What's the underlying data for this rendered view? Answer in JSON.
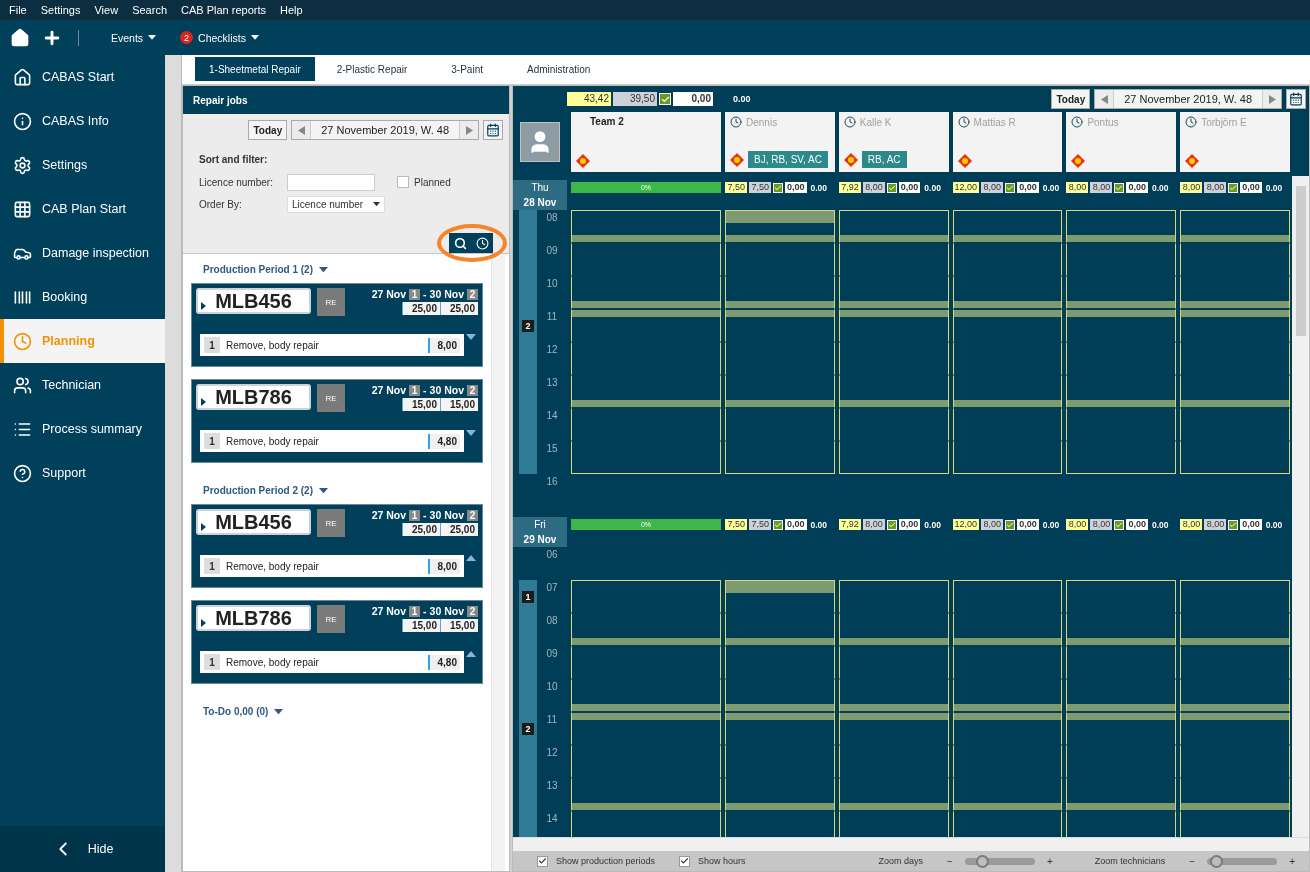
{
  "menu": [
    "File",
    "Settings",
    "View",
    "Search",
    "CAB Plan reports",
    "Help"
  ],
  "toolbar": {
    "events": "Events",
    "checklists": "Checklists",
    "badge": "2"
  },
  "sidebar": {
    "items": [
      {
        "label": "CABAS Start",
        "selected": false
      },
      {
        "label": "CABAS Info",
        "selected": false
      },
      {
        "label": "Settings",
        "selected": false
      },
      {
        "label": "CAB Plan Start",
        "selected": false
      },
      {
        "label": "Damage inspection",
        "selected": false
      },
      {
        "label": "Booking",
        "selected": false
      },
      {
        "label": "Planning",
        "selected": true
      },
      {
        "label": "Technician",
        "selected": false
      },
      {
        "label": "Process summary",
        "selected": false
      },
      {
        "label": "Support",
        "selected": false
      }
    ],
    "hide": "Hide"
  },
  "tabs": [
    {
      "label": "1-Sheetmetal Repair",
      "selected": true
    },
    {
      "label": "2-Plastic Repair",
      "selected": false
    },
    {
      "label": "3-Paint",
      "selected": false
    },
    {
      "label": "Administration",
      "selected": false
    }
  ],
  "repair_jobs": {
    "title": "Repair jobs",
    "today": "Today",
    "date": "27 November 2019, W. 48",
    "sort_title": "Sort and filter:",
    "licence_label": "Licence number:",
    "planned": {
      "label": "Planned",
      "checked": false
    },
    "order_label": "Order By:",
    "order_value": "Licence number",
    "groups": [
      {
        "title": "Production Period 1 (2)",
        "expanded": true,
        "jobs": [
          {
            "plate": "MLB456",
            "type": "RE",
            "start": "27 Nov",
            "start_day": "1",
            "separator": "-",
            "end": "30 Nov",
            "end_day": "2",
            "hours": [
              "25,00",
              "25,00"
            ],
            "task": {
              "index": "1",
              "name": "Remove, body repair",
              "hours": "8,00",
              "open": false
            }
          },
          {
            "plate": "MLB786",
            "type": "RE",
            "start": "27 Nov",
            "start_day": "1",
            "separator": "-",
            "end": "30 Nov",
            "end_day": "2",
            "hours": [
              "15,00",
              "15,00"
            ],
            "task": {
              "index": "1",
              "name": "Remove, body repair",
              "hours": "4,80",
              "open": false
            }
          }
        ]
      },
      {
        "title": "Production Period 2 (2)",
        "expanded": true,
        "jobs": [
          {
            "plate": "MLB456",
            "type": "RE",
            "start": "27 Nov",
            "start_day": "1",
            "separator": "-",
            "end": "30 Nov",
            "end_day": "2",
            "hours": [
              "25,00",
              "25,00"
            ],
            "task": {
              "index": "1",
              "name": "Remove, body repair",
              "hours": "8,00",
              "open": true
            }
          },
          {
            "plate": "MLB786",
            "type": "RE",
            "start": "27 Nov",
            "start_day": "1",
            "separator": "-",
            "end": "30 Nov",
            "end_day": "2",
            "hours": [
              "15,00",
              "15,00"
            ],
            "task": {
              "index": "1",
              "name": "Remove, body repair",
              "hours": "4,80",
              "open": true
            }
          }
        ]
      },
      {
        "title": "To-Do 0,00 (0)",
        "expanded": true
      }
    ]
  },
  "planner": {
    "totals": {
      "planned": "43,42",
      "capacity": "39,50",
      "done": "0,00",
      "extra": "0.00"
    },
    "today": "Today",
    "date": "27 November 2019, W. 48",
    "columns": [
      {
        "kind": "team",
        "name": "Team 2",
        "warning": true
      },
      {
        "kind": "technician",
        "name": "Dennis",
        "warning": true,
        "tags": "BJ, RB, SV, AC"
      },
      {
        "kind": "technician",
        "name": "Kalle K",
        "warning": true,
        "tags": "RB, AC"
      },
      {
        "kind": "technician",
        "name": "Mattias R",
        "warning": true
      },
      {
        "kind": "technician",
        "name": "Pontus",
        "warning": true
      },
      {
        "kind": "technician",
        "name": "Torbjörn E",
        "warning": true
      }
    ],
    "days": [
      {
        "weekday": "Thu",
        "date": "28 Nov",
        "team_progress": "0%",
        "stats": [
          {
            "planned": "7,50",
            "capacity": "7,50",
            "done": "0,00",
            "extra": "0.00",
            "booked": true
          },
          {
            "planned": "7,92",
            "capacity": "8,00",
            "done": "0,00",
            "extra": "0.00",
            "booked": false
          },
          {
            "planned": "12,00",
            "capacity": "8,00",
            "done": "0,00",
            "extra": "0.00",
            "booked": false
          },
          {
            "planned": "8,00",
            "capacity": "8,00",
            "done": "0,00",
            "extra": "0.00",
            "booked": false
          },
          {
            "planned": "8,00",
            "capacity": "8,00",
            "done": "0,00",
            "extra": "0.00",
            "booked": false
          }
        ],
        "hours": [
          {
            "label": "08",
            "in_period": true,
            "break_start": false,
            "break_end": true
          },
          {
            "label": "09",
            "in_period": true,
            "break_start": false,
            "break_end": false
          },
          {
            "label": "10",
            "in_period": true,
            "break_start": false,
            "break_end": true
          },
          {
            "label": "11",
            "in_period": true,
            "period_marker": "2",
            "break_start": true,
            "break_end": false
          },
          {
            "label": "12",
            "in_period": true,
            "break_start": false,
            "break_end": false
          },
          {
            "label": "13",
            "in_period": true,
            "break_start": false,
            "break_end": true
          },
          {
            "label": "14",
            "in_period": true,
            "break_start": false,
            "break_end": false
          },
          {
            "label": "15",
            "in_period": true,
            "break_start": false,
            "break_end": false
          },
          {
            "label": "16",
            "in_period": false,
            "break_start": false,
            "break_end": false
          }
        ]
      },
      {
        "weekday": "Fri",
        "date": "29 Nov",
        "team_progress": "0%",
        "stats": [
          {
            "planned": "7,50",
            "capacity": "7,50",
            "done": "0,00",
            "extra": "0.00",
            "booked": true
          },
          {
            "planned": "7,92",
            "capacity": "8,00",
            "done": "0,00",
            "extra": "0.00",
            "booked": false
          },
          {
            "planned": "12,00",
            "capacity": "8,00",
            "done": "0,00",
            "extra": "0.00",
            "booked": false
          },
          {
            "planned": "8,00",
            "capacity": "8,00",
            "done": "0,00",
            "extra": "0.00",
            "booked": false
          },
          {
            "planned": "8,00",
            "capacity": "8,00",
            "done": "0,00",
            "extra": "0.00",
            "booked": false
          }
        ],
        "hours": [
          {
            "label": "06",
            "in_period": false,
            "break_start": false,
            "break_end": false
          },
          {
            "label": "07",
            "in_period": true,
            "period_marker": "1",
            "break_start": false,
            "break_end": false
          },
          {
            "label": "08",
            "in_period": true,
            "break_start": false,
            "break_end": true
          },
          {
            "label": "09",
            "in_period": true,
            "break_start": false,
            "break_end": false
          },
          {
            "label": "10",
            "in_period": true,
            "break_start": false,
            "break_end": true
          },
          {
            "label": "11",
            "in_period": true,
            "period_marker": "2",
            "break_start": true,
            "break_end": false
          },
          {
            "label": "12",
            "in_period": true,
            "break_start": false,
            "break_end": false
          },
          {
            "label": "13",
            "in_period": true,
            "break_start": false,
            "break_end": true
          },
          {
            "label": "14",
            "in_period": true,
            "break_start": false,
            "break_end": false
          }
        ]
      }
    ],
    "footer": {
      "show_periods": {
        "label": "Show production periods",
        "checked": true
      },
      "show_hours": {
        "label": "Show hours",
        "checked": true
      },
      "zoom_days": {
        "label": "Zoom days",
        "minus": "−",
        "plus": "+",
        "level": 0.2
      },
      "zoom_technicians": {
        "label": "Zoom technicians",
        "minus": "−",
        "plus": "+",
        "level": 0.05
      }
    }
  }
}
